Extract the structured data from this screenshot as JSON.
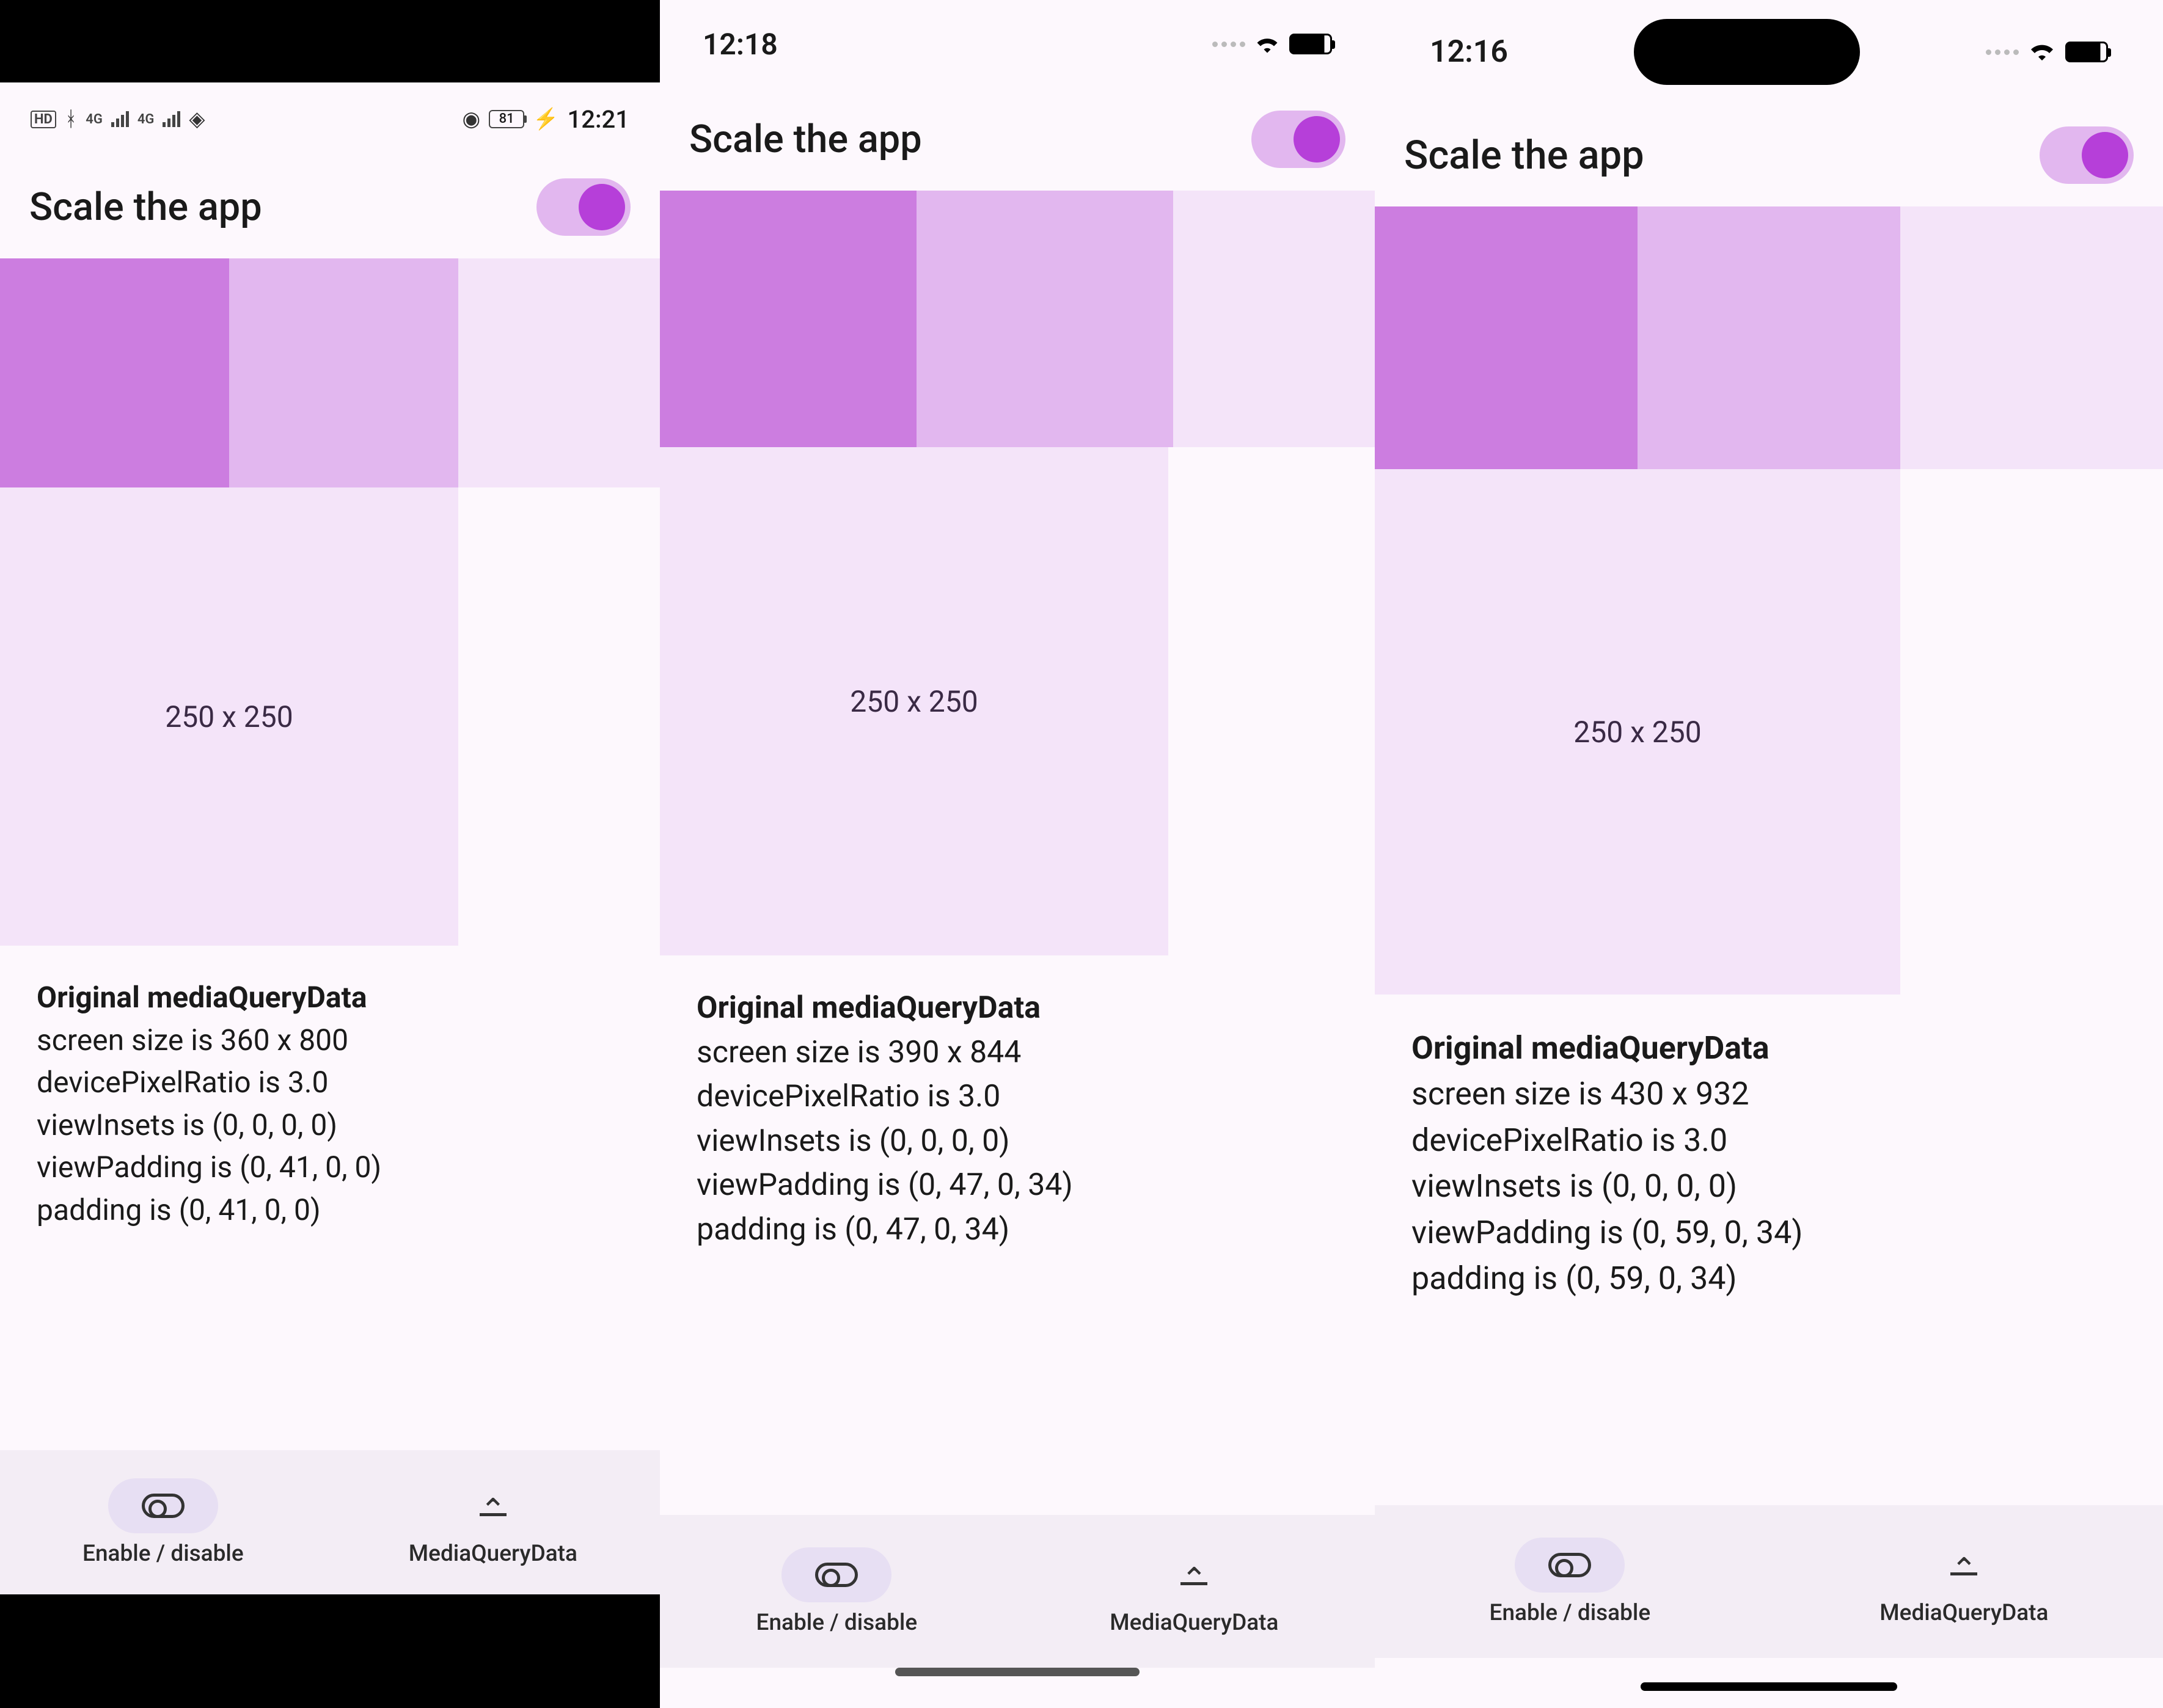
{
  "phones": [
    {
      "status": {
        "time": "12:21",
        "battery_text": "81"
      },
      "appbar": {
        "title": "Scale the app"
      },
      "box_label": "250 x 250",
      "media": {
        "title": "Original mediaQueryData",
        "lines": [
          "screen size is 360 x 800",
          "devicePixelRatio is 3.0",
          "viewInsets is (0, 0, 0, 0)",
          "viewPadding is (0, 41, 0, 0)",
          "padding is (0, 41, 0, 0)"
        ]
      }
    },
    {
      "status": {
        "time": "12:18"
      },
      "appbar": {
        "title": "Scale the app"
      },
      "box_label": "250 x 250",
      "media": {
        "title": "Original mediaQueryData",
        "lines": [
          "screen size is 390 x 844",
          "devicePixelRatio is 3.0",
          "viewInsets is (0, 0, 0, 0)",
          "viewPadding is (0, 47, 0, 34)",
          "padding is (0, 47, 0, 34)"
        ]
      }
    },
    {
      "status": {
        "time": "12:16"
      },
      "appbar": {
        "title": "Scale the app"
      },
      "box_label": "250 x 250",
      "media": {
        "title": "Original mediaQueryData",
        "lines": [
          "screen size is 430 x 932",
          "devicePixelRatio is 3.0",
          "viewInsets is (0, 0, 0, 0)",
          "viewPadding is (0, 59, 0, 34)",
          "padding is (0, 59, 0, 34)"
        ]
      }
    }
  ],
  "nav": {
    "item1_label": "Enable / disable",
    "item2_label": "MediaQueryData"
  }
}
